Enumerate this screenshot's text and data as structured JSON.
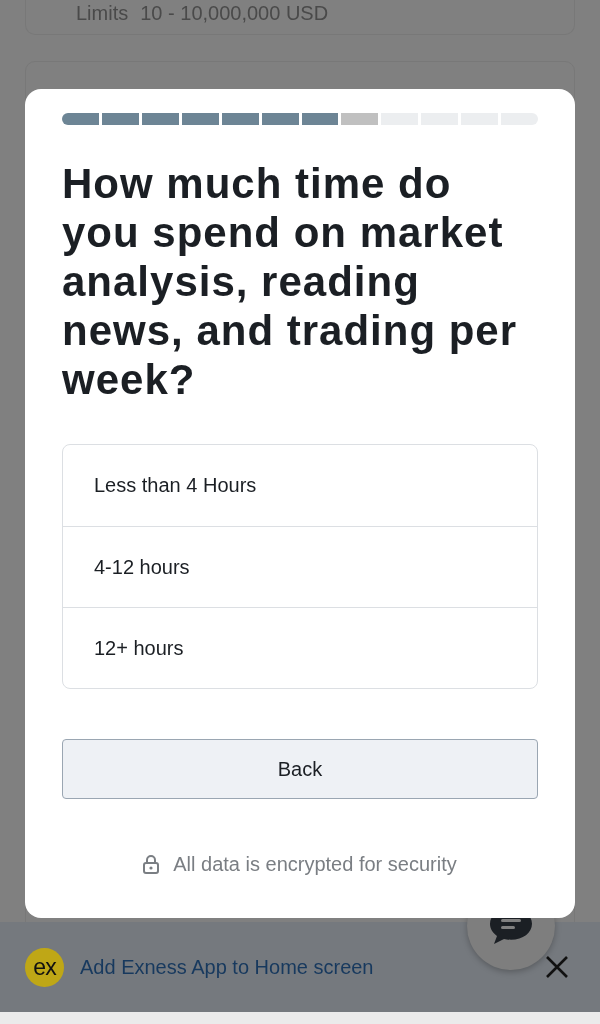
{
  "background": {
    "limits_label": "Limits",
    "limits_value": "10 - 10,000,000 USD"
  },
  "dialog": {
    "progress": [
      {
        "kind": "done"
      },
      {
        "kind": "done"
      },
      {
        "kind": "done"
      },
      {
        "kind": "done"
      },
      {
        "kind": "done"
      },
      {
        "kind": "done"
      },
      {
        "kind": "done"
      },
      {
        "kind": "current"
      },
      {
        "kind": "todo"
      },
      {
        "kind": "todo"
      },
      {
        "kind": "todo"
      },
      {
        "kind": "todo"
      }
    ],
    "question": "How much time do you spend on market analysis, reading news, and trading per week?",
    "options": [
      {
        "label": "Less than 4 Hours",
        "selected": false
      },
      {
        "label": "4-12 hours",
        "selected": false
      },
      {
        "label": "12+ hours",
        "selected": false
      }
    ],
    "back_button": "Back",
    "security_note": "All data is encrypted for security"
  },
  "install_banner": {
    "logo": "ex",
    "text": "Add Exness App to Home screen"
  }
}
